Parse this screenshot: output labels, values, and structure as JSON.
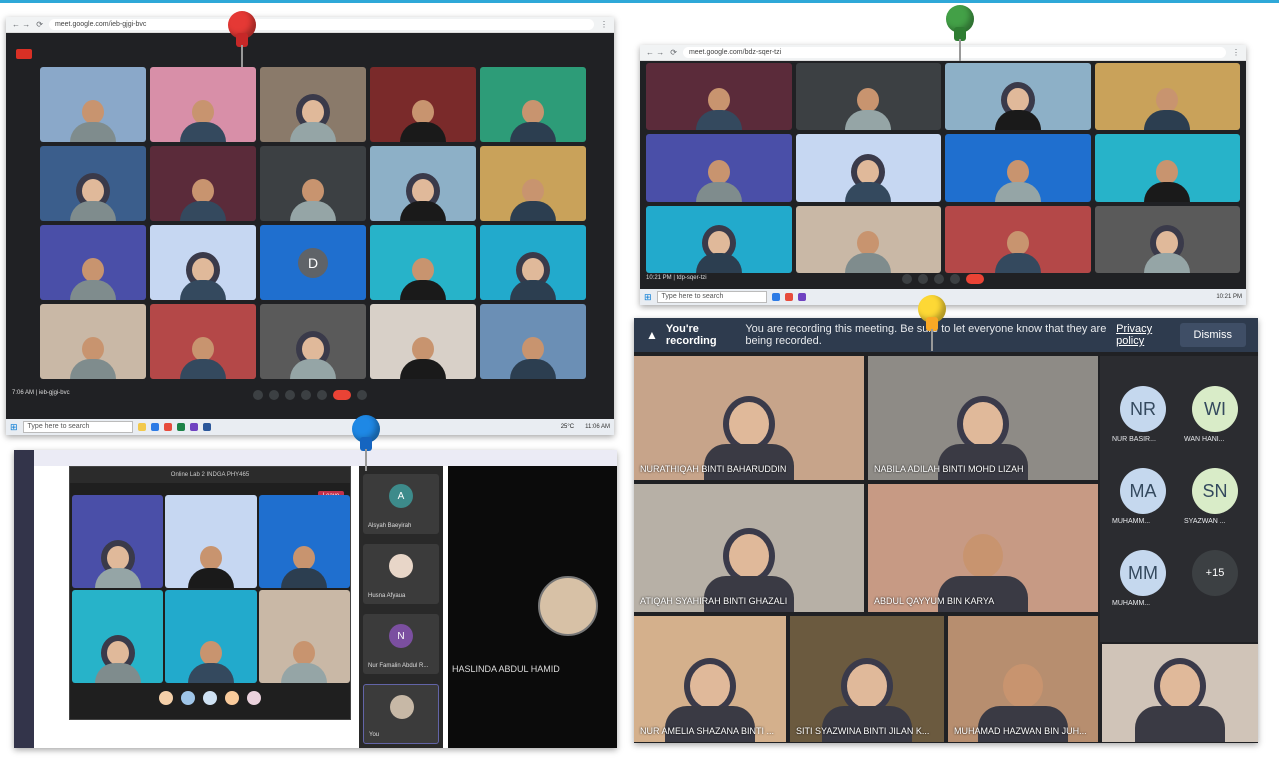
{
  "meet1": {
    "url": "meet.google.com/ieb-gjgi-bvc",
    "meeting_code": "7:06 AM | ieb-gjgi-bvc",
    "tiles": [
      "",
      "",
      "",
      "",
      "",
      "",
      "",
      "",
      "",
      "",
      "",
      "",
      "D",
      "",
      "",
      "",
      "",
      "",
      "",
      ""
    ],
    "taskbar_search": "Type here to search",
    "weather": "25°C",
    "clock": "11:06 AM"
  },
  "meet2": {
    "url": "meet.google.com/bdz-sqer-tzi",
    "meeting_code": "10:21 PM | tdp-sqer-tzi",
    "taskbar_search": "Type here to search",
    "clock": "10:21 PM"
  },
  "recording": {
    "title": "You're recording",
    "message": "You are recording this meeting. Be sure to let everyone know that they are being recorded.",
    "privacy_link": "Privacy policy",
    "dismiss": "Dismiss",
    "participants": [
      "NURATHIQAH BINTI BAHARUDDIN",
      "NABILA ADILAH BINTI MOHD LIZAH",
      "ATIQAH SYAHIRAH BINTI GHAZALI",
      "ABDUL QAYYUM BIN KARYA",
      "NUR AMELIA SHAZANA BINTI ...",
      "SITI SYAZWINA BINTI JILAN K...",
      "MUHAMAD HAZWAN BIN JUH..."
    ],
    "avatars": [
      {
        "initials": "NR",
        "name": "NUR BASIR...",
        "color": "#c5d8ee"
      },
      {
        "initials": "WI",
        "name": "WAN HANI...",
        "color": "#d9ecc8"
      },
      {
        "initials": "MA",
        "name": "MUHAMM...",
        "color": "#c5d8ee"
      },
      {
        "initials": "SN",
        "name": "SYAZWAN ...",
        "color": "#d9ecc8"
      },
      {
        "initials": "MM",
        "name": "MUHAMM...",
        "color": "#c5d8ee"
      },
      {
        "initials": "+15",
        "name": "",
        "color": "#3c4043"
      }
    ]
  },
  "teams": {
    "window_title": "Online Lab 2 INDGA PHY465",
    "leave": "Leave",
    "side": [
      {
        "initial": "A",
        "name": "Alsyah Baeyirah"
      },
      {
        "initial": "",
        "name": "Husna Afyaua"
      },
      {
        "initial": "N",
        "name": "Nur Famalin Abdul R..."
      },
      {
        "initial": "",
        "name": "You"
      }
    ],
    "stage_name": "HASLINDA ABDUL HAMID"
  }
}
